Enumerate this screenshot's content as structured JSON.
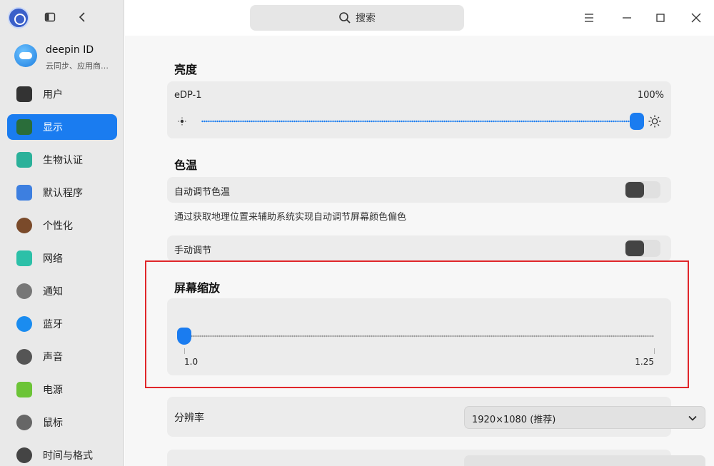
{
  "app": {
    "search_placeholder": "搜索"
  },
  "account": {
    "name": "deepin ID",
    "subtitle": "云同步、应用商…"
  },
  "sidebar": {
    "items": [
      {
        "label": "用户",
        "icon": "user-icon",
        "color": "#333333"
      },
      {
        "label": "显示",
        "icon": "display-icon",
        "color": "#2a6d3a",
        "active": true
      },
      {
        "label": "生物认证",
        "icon": "fingerprint-icon",
        "color": "#2bb19a"
      },
      {
        "label": "默认程序",
        "icon": "default-apps-icon",
        "color": "#3d7fe0"
      },
      {
        "label": "个性化",
        "icon": "palette-icon",
        "color": "#7a4a2a"
      },
      {
        "label": "网络",
        "icon": "network-icon",
        "color": "#2cc0a8"
      },
      {
        "label": "通知",
        "icon": "bell-icon",
        "color": "#777777"
      },
      {
        "label": "蓝牙",
        "icon": "bluetooth-icon",
        "color": "#1a8cf0"
      },
      {
        "label": "声音",
        "icon": "speaker-icon",
        "color": "#555555"
      },
      {
        "label": "电源",
        "icon": "battery-icon",
        "color": "#6cc437"
      },
      {
        "label": "鼠标",
        "icon": "mouse-icon",
        "color": "#666666"
      },
      {
        "label": "时间与格式",
        "icon": "clock-icon",
        "color": "#444444"
      }
    ]
  },
  "brightness": {
    "title": "亮度",
    "monitor": "eDP-1",
    "value_text": "100%",
    "level": 1.0
  },
  "color_temp": {
    "title": "色温",
    "auto_label": "自动调节色温",
    "auto_desc": "通过获取地理位置来辅助系统实现自动调节屏幕颜色偏色",
    "manual_label": "手动调节"
  },
  "scaling": {
    "title": "屏幕缩放",
    "min_label": "1.0",
    "max_label": "1.25",
    "level": 0.0
  },
  "resolution": {
    "label": "分辨率",
    "value": "1920×1080 (推荐)"
  },
  "colors": {
    "accent": "#1a7cf0",
    "highlight": "#e0262a"
  }
}
